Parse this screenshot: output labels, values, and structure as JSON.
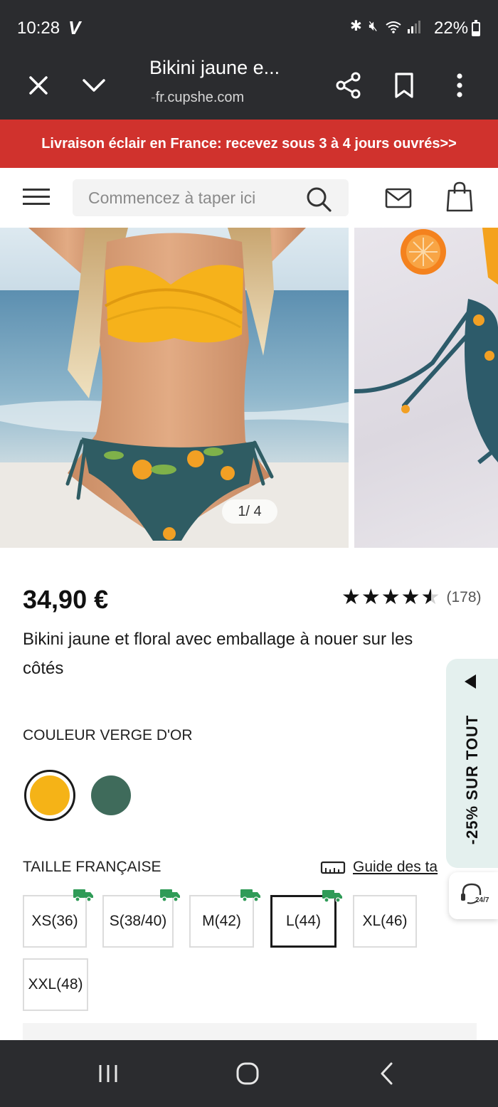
{
  "status_bar": {
    "time": "10:28",
    "carrier_logo": "V",
    "battery": "22%",
    "icons": [
      "bluetooth-icon",
      "mute-icon",
      "wifi-icon",
      "signal-icon",
      "battery-icon"
    ]
  },
  "browser_tab": {
    "title": "Bikini jaune e...",
    "url": "fr.cupshe.com",
    "icons": [
      "close-icon",
      "chevron-down-icon",
      "share-icon",
      "bookmark-icon",
      "more-vertical-icon"
    ]
  },
  "promo_banner": {
    "text": "Livraison éclair en France: recevez sous 3 à 4 jours ouvrés>>",
    "color": "#d0322d"
  },
  "header": {
    "search_placeholder": "Commencez à taper ici",
    "icons": [
      "menu-icon",
      "search-icon",
      "mail-icon",
      "shopping-bag-icon"
    ]
  },
  "gallery": {
    "counter": "1/ 4",
    "current": 1,
    "total": 4
  },
  "product": {
    "price": "34,90 €",
    "rating": 4.5,
    "stars": "★★★★★",
    "review_count": "(178)",
    "title": "Bikini jaune et floral avec emballage à nouer sur les côtés"
  },
  "color": {
    "label": "COULEUR VERGE D'OR",
    "swatches": [
      {
        "name": "yellow",
        "hex": "#f5b317",
        "selected": true
      },
      {
        "name": "green",
        "hex": "#3f6b5b",
        "selected": false
      }
    ]
  },
  "size": {
    "label": "TAILLE FRANÇAISE",
    "guide": "Guide des ta",
    "options": [
      {
        "label": "XS(36)",
        "express": true,
        "selected": false
      },
      {
        "label": "S(38/40)",
        "express": true,
        "selected": false
      },
      {
        "label": "M(42)",
        "express": true,
        "selected": false
      },
      {
        "label": "L(44)",
        "express": true,
        "selected": true
      },
      {
        "label": "XL(46)",
        "express": false,
        "selected": false
      },
      {
        "label": "XXL(48)",
        "express": false,
        "selected": false
      }
    ]
  },
  "side_promo": {
    "text": "-25% SUR TOUT",
    "chat_label": "24/7"
  },
  "nav": {
    "icons": [
      "recent-apps-icon",
      "home-icon",
      "back-icon"
    ]
  }
}
